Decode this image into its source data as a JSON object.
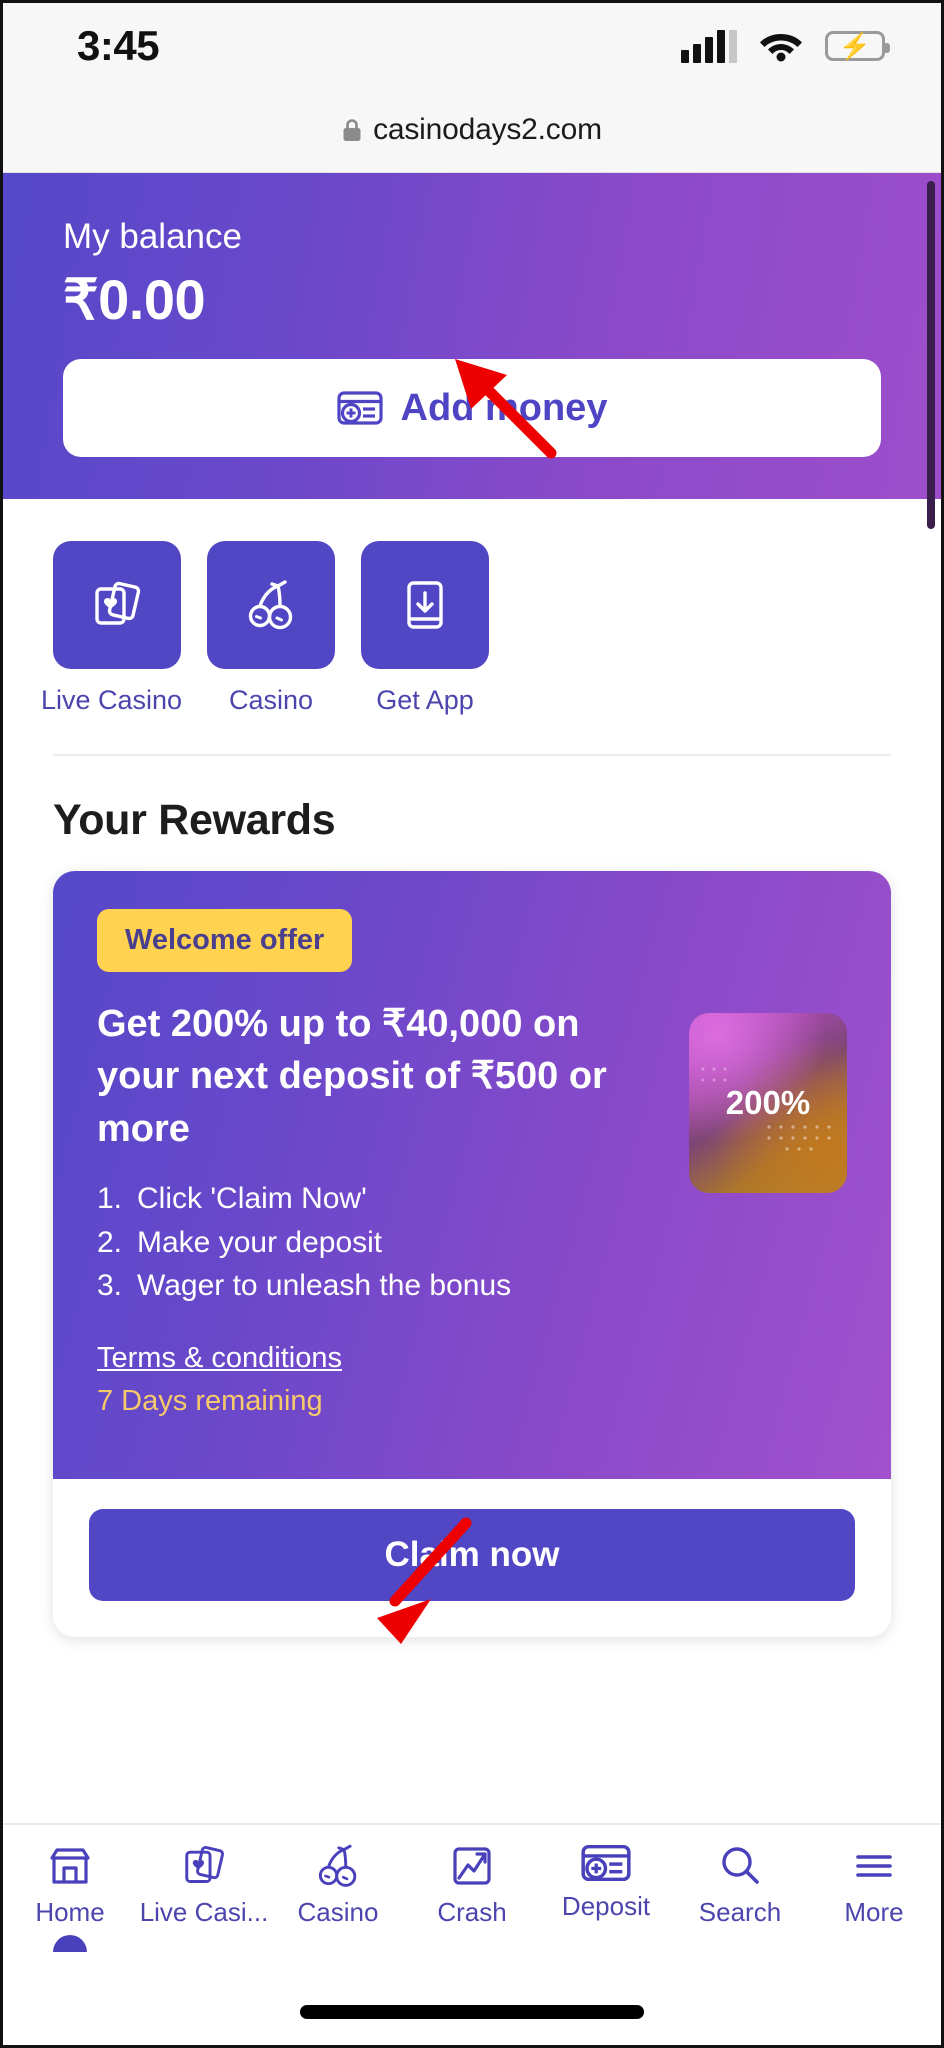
{
  "status_bar": {
    "time": "3:45",
    "cellular_icon": "signal-bars-icon",
    "wifi_icon": "wifi-icon",
    "battery_icon": "battery-charging-icon"
  },
  "browser": {
    "lock_icon": "lock-icon",
    "url": "casinodays2.com"
  },
  "balance": {
    "label": "My balance",
    "amount": "₹0.00",
    "add_money_label": "Add money",
    "add_money_icon": "card-plus-icon"
  },
  "quick_tiles": [
    {
      "label": "Live Casino",
      "icon": "playing-cards-icon"
    },
    {
      "label": "Casino",
      "icon": "cherries-icon"
    },
    {
      "label": "Get App",
      "icon": "phone-download-icon"
    }
  ],
  "rewards": {
    "section_title": "Your Rewards",
    "badge": "Welcome offer",
    "headline": "Get 200% up to ₹40,000 on your next deposit of ₹500 or more",
    "steps": [
      {
        "num": "1.",
        "text": "Click 'Claim Now'"
      },
      {
        "num": "2.",
        "text": "Make your deposit"
      },
      {
        "num": "3.",
        "text": "Wager to unleash the bonus"
      }
    ],
    "terms_label": "Terms & conditions",
    "days_remaining": "7 Days remaining",
    "promo_percent": "200%",
    "claim_label": "Claim now"
  },
  "bottom_nav": [
    {
      "label": "Home",
      "icon": "store-icon",
      "active": true
    },
    {
      "label": "Live Casi...",
      "icon": "playing-cards-icon",
      "active": false
    },
    {
      "label": "Casino",
      "icon": "cherries-icon",
      "active": false
    },
    {
      "label": "Crash",
      "icon": "chart-up-icon",
      "active": false
    },
    {
      "label": "Deposit",
      "icon": "card-plus-icon",
      "active": false
    },
    {
      "label": "Search",
      "icon": "search-icon",
      "active": false
    },
    {
      "label": "More",
      "icon": "hamburger-icon",
      "active": false
    }
  ],
  "colors": {
    "brand_purple": "#5146c4",
    "gradient_start": "#5548c9",
    "gradient_end": "#9e4ecb",
    "badge_yellow": "#ffd24f",
    "days_gold": "#f6c96a",
    "label_purple": "#4d45ae"
  }
}
